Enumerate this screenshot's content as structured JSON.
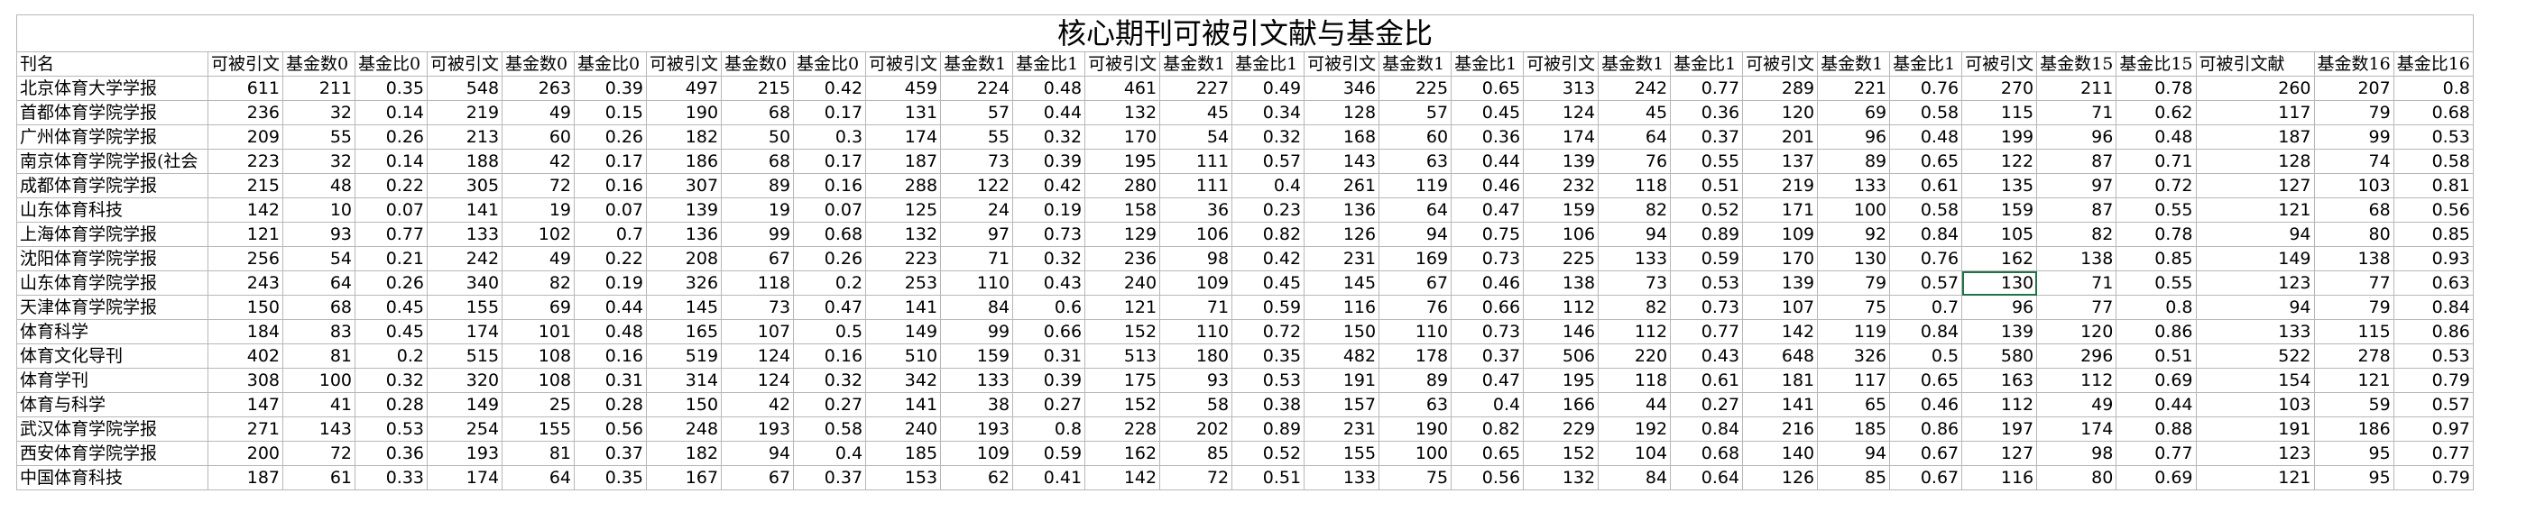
{
  "title": "核心期刊可被引文献与基金比",
  "headers": [
    "刊名",
    "可被引文",
    "基金数0",
    "基金比0",
    "可被引文",
    "基金数0",
    "基金比0",
    "可被引文",
    "基金数0",
    "基金比0",
    "可被引文",
    "基金数1",
    "基金比1",
    "可被引文",
    "基金数1",
    "基金比1",
    "可被引文",
    "基金数1",
    "基金比1",
    "可被引文",
    "基金数1",
    "基金比1",
    "可被引文",
    "基金数1",
    "基金比1",
    "可被引文",
    "基金数15",
    "基金比15",
    "可被引文献",
    "基金数16",
    "基金比16"
  ],
  "rows": [
    [
      "北京体育大学学报",
      "611",
      "211",
      "0.35",
      "548",
      "263",
      "0.39",
      "497",
      "215",
      "0.42",
      "459",
      "224",
      "0.48",
      "461",
      "227",
      "0.49",
      "346",
      "225",
      "0.65",
      "313",
      "242",
      "0.77",
      "289",
      "221",
      "0.76",
      "270",
      "211",
      "0.78",
      "260",
      "207",
      "0.8"
    ],
    [
      "首都体育学院学报",
      "236",
      "32",
      "0.14",
      "219",
      "49",
      "0.15",
      "190",
      "68",
      "0.17",
      "131",
      "57",
      "0.44",
      "132",
      "45",
      "0.34",
      "128",
      "57",
      "0.45",
      "124",
      "45",
      "0.36",
      "120",
      "69",
      "0.58",
      "115",
      "71",
      "0.62",
      "117",
      "79",
      "0.68"
    ],
    [
      "广州体育学院学报",
      "209",
      "55",
      "0.26",
      "213",
      "60",
      "0.26",
      "182",
      "50",
      "0.3",
      "174",
      "55",
      "0.32",
      "170",
      "54",
      "0.32",
      "168",
      "60",
      "0.36",
      "174",
      "64",
      "0.37",
      "201",
      "96",
      "0.48",
      "199",
      "96",
      "0.48",
      "187",
      "99",
      "0.53"
    ],
    [
      "南京体育学院学报(社会",
      "223",
      "32",
      "0.14",
      "188",
      "42",
      "0.17",
      "186",
      "68",
      "0.17",
      "187",
      "73",
      "0.39",
      "195",
      "111",
      "0.57",
      "143",
      "63",
      "0.44",
      "139",
      "76",
      "0.55",
      "137",
      "89",
      "0.65",
      "122",
      "87",
      "0.71",
      "128",
      "74",
      "0.58"
    ],
    [
      "成都体育学院学报",
      "215",
      "48",
      "0.22",
      "305",
      "72",
      "0.16",
      "307",
      "89",
      "0.16",
      "288",
      "122",
      "0.42",
      "280",
      "111",
      "0.4",
      "261",
      "119",
      "0.46",
      "232",
      "118",
      "0.51",
      "219",
      "133",
      "0.61",
      "135",
      "97",
      "0.72",
      "127",
      "103",
      "0.81"
    ],
    [
      "山东体育科技",
      "142",
      "10",
      "0.07",
      "141",
      "19",
      "0.07",
      "139",
      "19",
      "0.07",
      "125",
      "24",
      "0.19",
      "158",
      "36",
      "0.23",
      "136",
      "64",
      "0.47",
      "159",
      "82",
      "0.52",
      "171",
      "100",
      "0.58",
      "159",
      "87",
      "0.55",
      "121",
      "68",
      "0.56"
    ],
    [
      "上海体育学院学报",
      "121",
      "93",
      "0.77",
      "133",
      "102",
      "0.7",
      "136",
      "99",
      "0.68",
      "132",
      "97",
      "0.73",
      "129",
      "106",
      "0.82",
      "126",
      "94",
      "0.75",
      "106",
      "94",
      "0.89",
      "109",
      "92",
      "0.84",
      "105",
      "82",
      "0.78",
      "94",
      "80",
      "0.85"
    ],
    [
      "沈阳体育学院学报",
      "256",
      "54",
      "0.21",
      "242",
      "49",
      "0.22",
      "208",
      "67",
      "0.26",
      "223",
      "71",
      "0.32",
      "236",
      "98",
      "0.42",
      "231",
      "169",
      "0.73",
      "225",
      "133",
      "0.59",
      "170",
      "130",
      "0.76",
      "162",
      "138",
      "0.85",
      "149",
      "138",
      "0.93"
    ],
    [
      "山东体育学院学报",
      "243",
      "64",
      "0.26",
      "340",
      "82",
      "0.19",
      "326",
      "118",
      "0.2",
      "253",
      "110",
      "0.43",
      "240",
      "109",
      "0.45",
      "145",
      "67",
      "0.46",
      "138",
      "73",
      "0.53",
      "139",
      "79",
      "0.57",
      "130",
      "71",
      "0.55",
      "123",
      "77",
      "0.63"
    ],
    [
      "天津体育学院学报",
      "150",
      "68",
      "0.45",
      "155",
      "69",
      "0.44",
      "145",
      "73",
      "0.47",
      "141",
      "84",
      "0.6",
      "121",
      "71",
      "0.59",
      "116",
      "76",
      "0.66",
      "112",
      "82",
      "0.73",
      "107",
      "75",
      "0.7",
      "96",
      "77",
      "0.8",
      "94",
      "79",
      "0.84"
    ],
    [
      "体育科学",
      "184",
      "83",
      "0.45",
      "174",
      "101",
      "0.48",
      "165",
      "107",
      "0.5",
      "149",
      "99",
      "0.66",
      "152",
      "110",
      "0.72",
      "150",
      "110",
      "0.73",
      "146",
      "112",
      "0.77",
      "142",
      "119",
      "0.84",
      "139",
      "120",
      "0.86",
      "133",
      "115",
      "0.86"
    ],
    [
      "体育文化导刊",
      "402",
      "81",
      "0.2",
      "515",
      "108",
      "0.16",
      "519",
      "124",
      "0.16",
      "510",
      "159",
      "0.31",
      "513",
      "180",
      "0.35",
      "482",
      "178",
      "0.37",
      "506",
      "220",
      "0.43",
      "648",
      "326",
      "0.5",
      "580",
      "296",
      "0.51",
      "522",
      "278",
      "0.53"
    ],
    [
      "体育学刊",
      "308",
      "100",
      "0.32",
      "320",
      "108",
      "0.31",
      "314",
      "124",
      "0.32",
      "342",
      "133",
      "0.39",
      "175",
      "93",
      "0.53",
      "191",
      "89",
      "0.47",
      "195",
      "118",
      "0.61",
      "181",
      "117",
      "0.65",
      "163",
      "112",
      "0.69",
      "154",
      "121",
      "0.79"
    ],
    [
      "体育与科学",
      "147",
      "41",
      "0.28",
      "149",
      "25",
      "0.28",
      "150",
      "42",
      "0.27",
      "141",
      "38",
      "0.27",
      "152",
      "58",
      "0.38",
      "157",
      "63",
      "0.4",
      "166",
      "44",
      "0.27",
      "141",
      "65",
      "0.46",
      "112",
      "49",
      "0.44",
      "103",
      "59",
      "0.57"
    ],
    [
      "武汉体育学院学报",
      "271",
      "143",
      "0.53",
      "254",
      "155",
      "0.56",
      "248",
      "193",
      "0.58",
      "240",
      "193",
      "0.8",
      "228",
      "202",
      "0.89",
      "231",
      "190",
      "0.82",
      "229",
      "192",
      "0.84",
      "216",
      "185",
      "0.86",
      "197",
      "174",
      "0.88",
      "191",
      "186",
      "0.97"
    ],
    [
      "西安体育学院学报",
      "200",
      "72",
      "0.36",
      "193",
      "81",
      "0.37",
      "182",
      "94",
      "0.4",
      "185",
      "109",
      "0.59",
      "162",
      "85",
      "0.52",
      "155",
      "100",
      "0.65",
      "152",
      "104",
      "0.68",
      "140",
      "94",
      "0.67",
      "127",
      "98",
      "0.77",
      "123",
      "95",
      "0.77"
    ],
    [
      "中国体育科技",
      "187",
      "61",
      "0.33",
      "174",
      "64",
      "0.35",
      "167",
      "67",
      "0.37",
      "153",
      "62",
      "0.41",
      "142",
      "72",
      "0.51",
      "133",
      "75",
      "0.56",
      "132",
      "84",
      "0.64",
      "126",
      "85",
      "0.67",
      "116",
      "80",
      "0.69",
      "121",
      "95",
      "0.79"
    ]
  ]
}
